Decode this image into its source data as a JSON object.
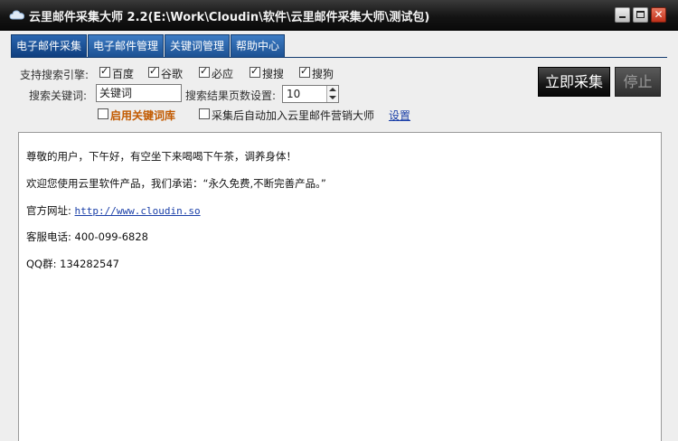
{
  "window": {
    "title": "云里邮件采集大师 2.2(E:\\Work\\Cloudin\\软件\\云里邮件采集大师\\测试包)",
    "close_glyph": "✕"
  },
  "tabs": [
    {
      "label": "电子邮件采集",
      "active": true
    },
    {
      "label": "电子邮件管理",
      "active": false
    },
    {
      "label": "关键词管理",
      "active": false
    },
    {
      "label": "帮助中心",
      "active": false
    }
  ],
  "options": {
    "engines_label": "支持搜索引擎:",
    "engines": [
      {
        "label": "百度",
        "checked": true
      },
      {
        "label": "谷歌",
        "checked": true
      },
      {
        "label": "必应",
        "checked": true
      },
      {
        "label": "搜搜",
        "checked": true
      },
      {
        "label": "搜狗",
        "checked": true
      }
    ],
    "keyword_label": "搜索关键词:",
    "keyword_value": "关键词",
    "pages_label": "搜索结果页数设置:",
    "pages_value": "10",
    "enable_keyword_lib": {
      "label": "启用关键词库",
      "checked": false
    },
    "auto_add": {
      "label": "采集后自动加入云里邮件营销大师",
      "checked": false
    },
    "settings_link": "设置"
  },
  "buttons": {
    "start": "立即采集",
    "stop": "停止"
  },
  "content": {
    "greeting": "尊敬的用户，下午好，有空坐下来喝喝下午茶，调养身体！",
    "promise": "欢迎您使用云里软件产品，我们承诺：“永久免费,不断完善产品。”",
    "website_label": "官方网址:",
    "website_url": "http://www.cloudin.so",
    "phone_label": "客服电话:",
    "phone": "400-099-6828",
    "qq_label": "QQ群:",
    "qq": "134282547"
  },
  "colors": {
    "tab_blue": "#1b4f91",
    "title_bar": "#141414",
    "link": "#1a3fa8",
    "highlight_orange": "#c25a00"
  }
}
